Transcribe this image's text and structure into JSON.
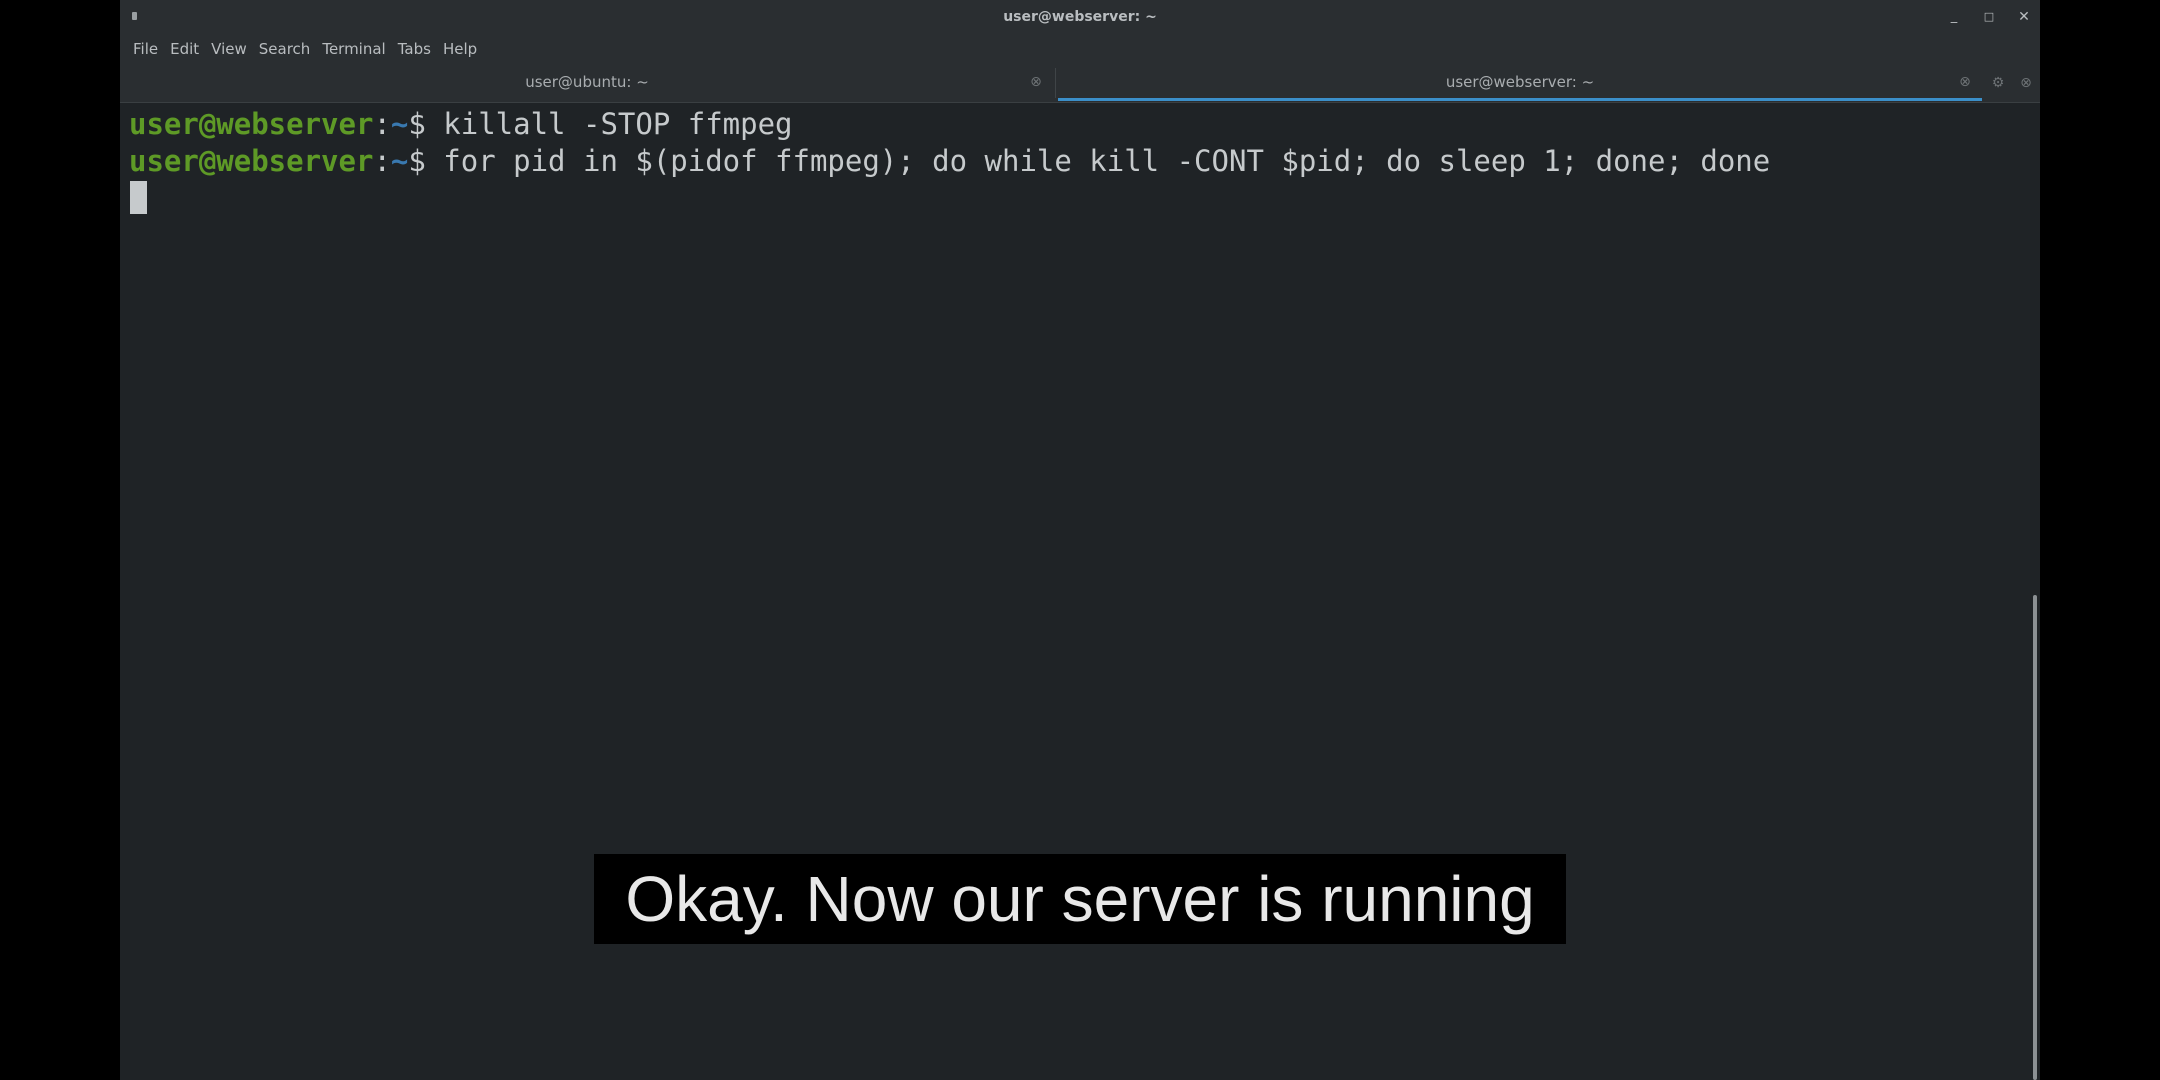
{
  "window": {
    "title": "user@webserver: ~",
    "controls": {
      "minimize_icon": "minimize-icon",
      "maximize_icon": "maximize-icon",
      "close_icon": "close-icon"
    }
  },
  "menubar": {
    "items": [
      "File",
      "Edit",
      "View",
      "Search",
      "Terminal",
      "Tabs",
      "Help"
    ]
  },
  "tabs": [
    {
      "label": "user@ubuntu: ~",
      "active": false
    },
    {
      "label": "user@webserver: ~",
      "active": true
    }
  ],
  "terminal": {
    "lines": [
      {
        "user_host": "user@webserver",
        "colon": ":",
        "path": "~",
        "dollar": "$",
        "command": " killall -STOP ffmpeg"
      },
      {
        "user_host": "user@webserver",
        "colon": ":",
        "path": "~",
        "dollar": "$",
        "command": " for pid in $(pidof ffmpeg); do while kill -CONT $pid; do sleep 1; done; done"
      }
    ]
  },
  "subtitle": {
    "text": "Okay. Now our server is running"
  },
  "colors": {
    "background": "#1f2326",
    "chrome": "#2a2e31",
    "prompt_user": "#5e9a26",
    "prompt_path": "#3979b0",
    "active_tab_accent": "#3b8fc9",
    "text": "#c6cacc"
  }
}
